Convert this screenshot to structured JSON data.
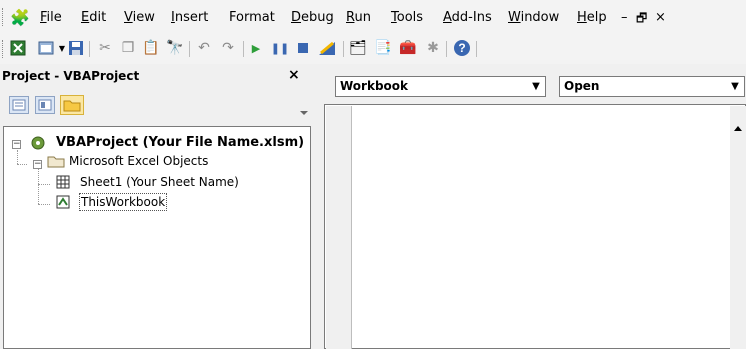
{
  "menubar": {
    "items": [
      "File",
      "Edit",
      "View",
      "Insert",
      "Format",
      "Debug",
      "Run",
      "Tools",
      "Add-Ins",
      "Window",
      "Help"
    ],
    "window_controls": [
      "–",
      "🗗",
      "×"
    ]
  },
  "toolbar": {
    "icons": [
      "excel-icon",
      "userform-icon",
      "save-icon",
      "cut-icon",
      "copy-icon",
      "paste-icon",
      "find-icon",
      "undo-icon",
      "redo-icon",
      "run-icon",
      "break-icon",
      "reset-icon",
      "design-mode-icon",
      "project-explorer-icon",
      "properties-icon",
      "object-browser-icon",
      "toolbox-icon",
      "help-icon"
    ]
  },
  "project": {
    "title": "Project - VBAProject",
    "close": "×",
    "root": "VBAProject (Your File Name.xlsm)",
    "folder": "Microsoft Excel Objects",
    "sheet": "Sheet1 (Your Sheet Name)",
    "workbook": "ThisWorkbook"
  },
  "code": {
    "object_combo": "Workbook",
    "procedure_combo": "Open"
  }
}
